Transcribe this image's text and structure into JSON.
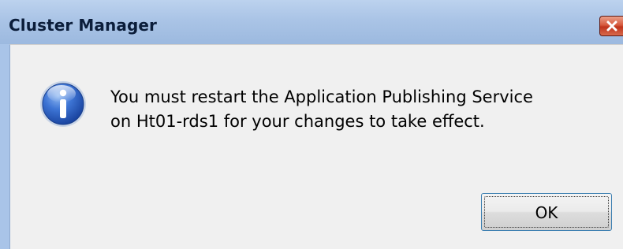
{
  "window": {
    "title": "Cluster Manager",
    "titlebar_color": "#a9c4e8",
    "client_background": "#f0f0f0"
  },
  "close_button": {
    "icon": "close-icon",
    "color": "#c9452b"
  },
  "dialog": {
    "icon": "info-icon",
    "message_line_1": "You must restart the Application Publishing Service",
    "message_line_2": "on Ht01-rds1 for your changes to take effect."
  },
  "buttons": {
    "ok_label": "OK"
  }
}
